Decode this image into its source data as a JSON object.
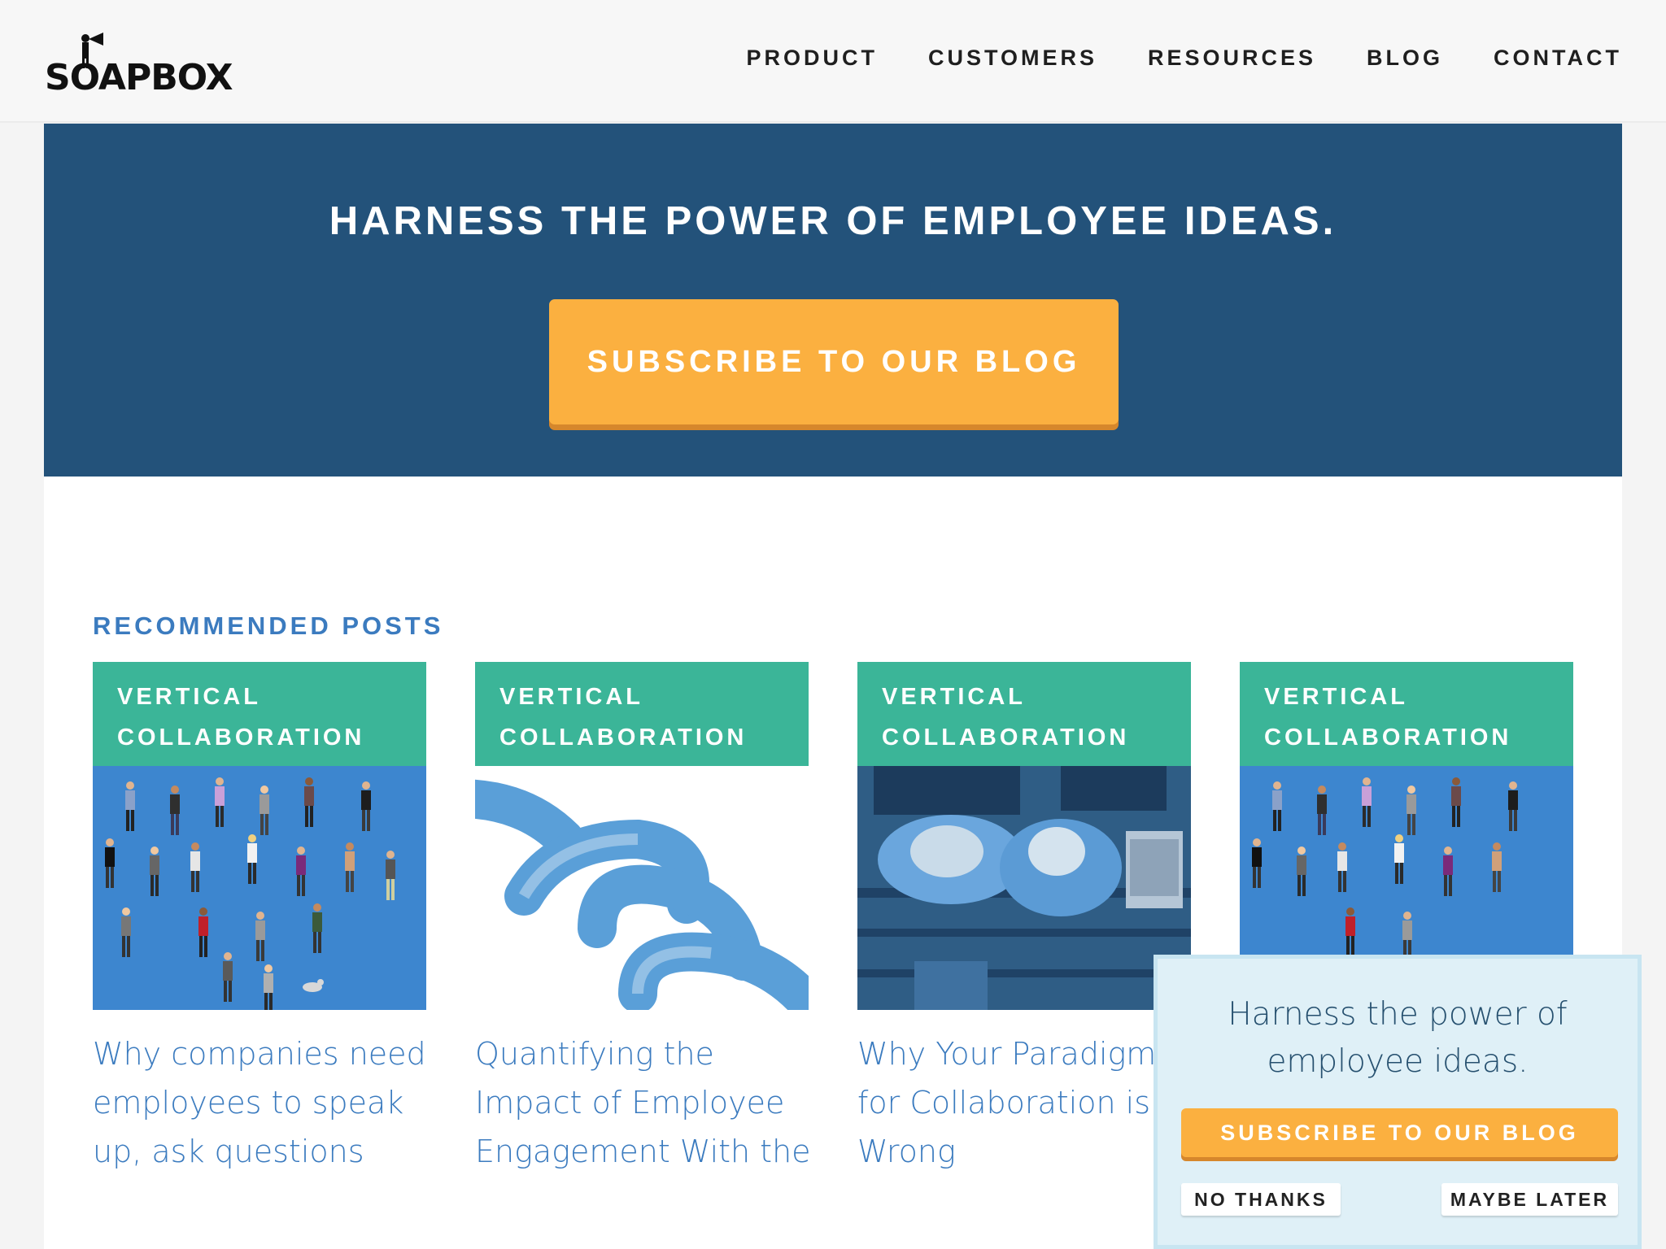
{
  "header": {
    "logo_text": "SOAPBOX",
    "nav": [
      "PRODUCT",
      "CUSTOMERS",
      "RESOURCES",
      "BLOG",
      "CONTACT"
    ]
  },
  "hero": {
    "title": "HARNESS THE POWER OF EMPLOYEE IDEAS.",
    "button_label": "SUBSCRIBE TO OUR BLOG"
  },
  "recommended": {
    "heading": "RECOMMENDED POSTS",
    "posts": [
      {
        "tag": "VERTICAL COLLABORATION",
        "title": "Why companies need employees to speak up, ask questions",
        "image": "crowd-illustration"
      },
      {
        "tag": "VERTICAL COLLABORATION",
        "title": "Quantifying the Impact of Employee Engagement With the",
        "image": "chain-link"
      },
      {
        "tag": "VERTICAL COLLABORATION",
        "title": "Why Your Paradigm for Collaboration is Wrong",
        "image": "people-laptop"
      },
      {
        "tag": "VERTICAL COLLABORATION",
        "title": "",
        "image": "crowd-illustration"
      }
    ]
  },
  "popup": {
    "text": "Harness the power of employee ideas.",
    "subscribe_label": "SUBSCRIBE TO OUR BLOG",
    "no_thanks_label": "NO THANKS",
    "maybe_later_label": "MAYBE LATER"
  },
  "colors": {
    "hero_bg": "#23527a",
    "accent_orange": "#fbb040",
    "tag_green": "#3bb598",
    "link_blue": "#3b7bbf"
  }
}
